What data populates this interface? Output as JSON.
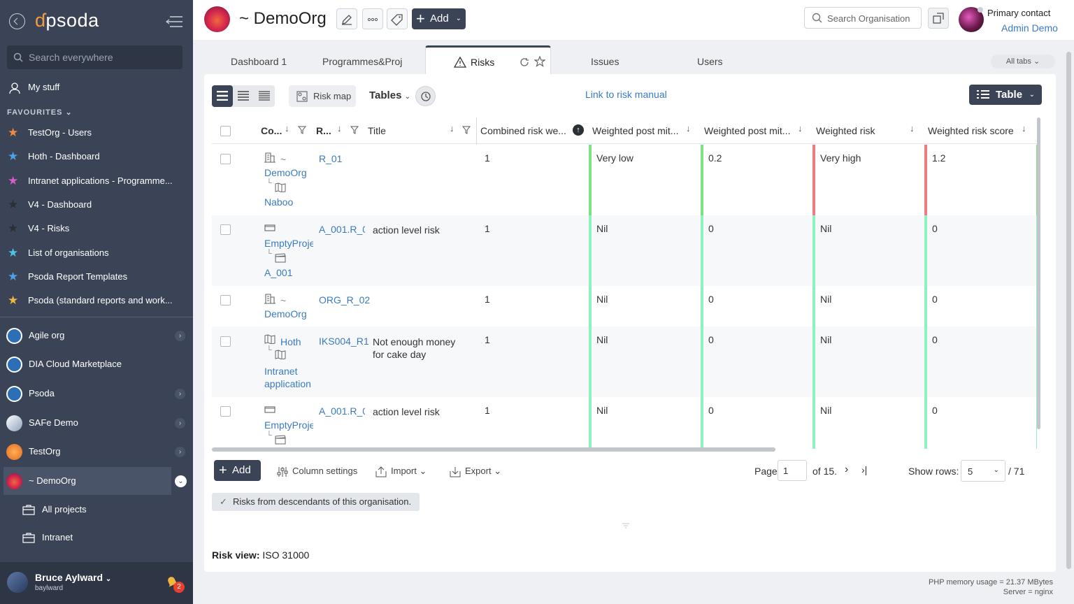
{
  "sidebar": {
    "logo": "psoda",
    "search_placeholder": "Search everywhere",
    "my_stuff": "My stuff",
    "favourites_label": "FAVOURITES",
    "favourites": [
      {
        "label": "TestOrg - Users",
        "star_color": "#f28a3d"
      },
      {
        "label": "Hoth - Dashboard",
        "star_color": "#4aa3e8"
      },
      {
        "label": "Intranet applications - Programme...",
        "star_color": "#d95ac9"
      },
      {
        "label": "V4 - Dashboard",
        "star_color": "#2b2f36"
      },
      {
        "label": "V4 - Risks",
        "star_color": "#2b2f36"
      },
      {
        "label": "List of organisations",
        "star_color": "#4dc4e6"
      },
      {
        "label": "Psoda Report Templates",
        "star_color": "#4aa3e8"
      },
      {
        "label": "Psoda (standard reports and work...",
        "star_color": "#f0b63d"
      }
    ],
    "orgs": [
      {
        "label": "Agile org"
      },
      {
        "label": "DIA Cloud Marketplace"
      },
      {
        "label": "Psoda"
      },
      {
        "label": "SAFe Demo"
      },
      {
        "label": "TestOrg"
      },
      {
        "label": "~ DemoOrg"
      }
    ],
    "sub_items": [
      {
        "label": "All projects"
      },
      {
        "label": "Intranet"
      }
    ],
    "user": {
      "name": "Bruce Aylward",
      "handle": "baylward",
      "notifications": "2"
    }
  },
  "header": {
    "title": "~ DemoOrg",
    "add_label": "Add",
    "search_placeholder": "Search Organisation",
    "contact_role": "Primary contact",
    "contact_name": "Admin Demo"
  },
  "tabs": {
    "items": [
      "Dashboard 1",
      "Programmes&Proj",
      "Risks",
      "Issues",
      "Users"
    ],
    "all_tabs": "All tabs"
  },
  "toolbar": {
    "risk_map": "Risk map",
    "tables": "Tables",
    "risk_manual": "Link to risk manual",
    "table_view": "Table"
  },
  "columns": {
    "co": "Co...",
    "r": "R...",
    "title": "Title",
    "combined": "Combined risk we...",
    "wpm1": "Weighted post mit...",
    "wpm2": "Weighted post mit...",
    "weighted_risk": "Weighted risk",
    "weighted_score": "Weighted risk score"
  },
  "rows": [
    {
      "co1": "~",
      "co2": "DemoOrg",
      "co3": "Naboo",
      "r": "R_01",
      "title1": "",
      "title2": "",
      "combined": "1",
      "wpm1": "Very low",
      "wpm2": "0.2",
      "wr": "Very high",
      "wrs": "1.2",
      "bar1": "#7fe07f",
      "bar2": "#f07a80"
    },
    {
      "co1": "",
      "co2": "EmptyProje",
      "co3": "A_001",
      "r": "A_001.R_0",
      "title1": "action level risk",
      "title2": "",
      "combined": "1",
      "wpm1": "Nil",
      "wpm2": "0",
      "wr": "Nil",
      "wrs": "0",
      "bar1": "#8ff0c0",
      "bar2": "#8ff0c0"
    },
    {
      "co1": "~",
      "co2": "DemoOrg",
      "co3": "",
      "r": "ORG_R_02",
      "title1": "",
      "title2": "",
      "combined": "1",
      "wpm1": "Nil",
      "wpm2": "0",
      "wr": "Nil",
      "wrs": "0",
      "bar1": "#8ff0c0",
      "bar2": "#8ff0c0"
    },
    {
      "co1": "Hoth",
      "co2": "Intranet",
      "co3": "application",
      "r": "IKS004_R1",
      "title1": "Not enough money",
      "title2": "for cake day",
      "combined": "1",
      "wpm1": "Nil",
      "wpm2": "0",
      "wr": "Nil",
      "wrs": "0",
      "bar1": "#8ff0c0",
      "bar2": "#8ff0c0"
    },
    {
      "co1": "",
      "co2": "EmptyProje",
      "co3": "",
      "r": "A_001.R_0",
      "title1": "action level risk",
      "title2": "",
      "combined": "1",
      "wpm1": "Nil",
      "wpm2": "0",
      "wr": "Nil",
      "wrs": "0",
      "bar1": "#8ff0c0",
      "bar2": "#8ff0c0"
    }
  ],
  "bottom": {
    "add": "Add",
    "column_settings": "Column settings",
    "import": "Import",
    "export": "Export",
    "page_label": "Page",
    "page_value": "1",
    "of_pages": "of 15.",
    "show_rows_label": "Show rows:",
    "rows_value": "5",
    "total": "/ 71"
  },
  "filter_chip": "Risks from descendants of this organisation.",
  "risk_view_label": "Risk view:",
  "risk_view_value": "ISO 31000",
  "footer": {
    "memory": "PHP memory usage = 21.37 MBytes",
    "server": "Server = nginx"
  }
}
